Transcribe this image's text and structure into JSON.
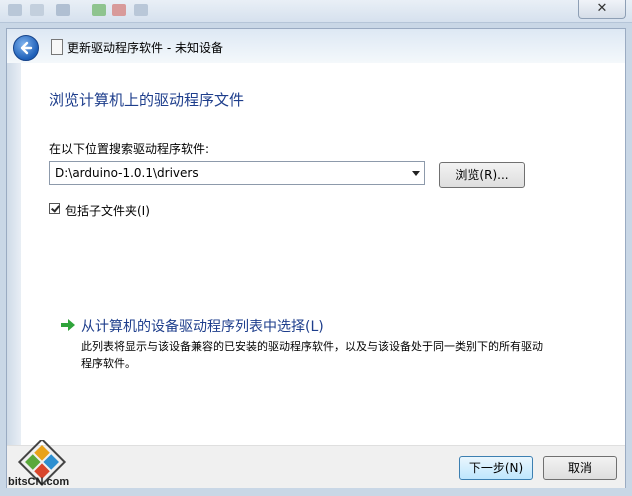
{
  "window": {
    "title": "更新驱动程序软件 - 未知设备",
    "close_glyph": "✕"
  },
  "page": {
    "heading": "浏览计算机上的驱动程序文件",
    "search_label": "在以下位置搜索驱动程序软件:",
    "path_value": "D:\\arduino-1.0.1\\drivers",
    "browse_label": "浏览(R)...",
    "include_subfolders_label": "包括子文件夹(I)",
    "include_subfolders_checked": true,
    "pick_link": "从计算机的设备驱动程序列表中选择(L)",
    "pick_description": "此列表将显示与该设备兼容的已安装的驱动程序软件，以及与该设备处于同一类别下的所有驱动程序软件。"
  },
  "footer": {
    "next_label": "下一步(N)",
    "cancel_label": "取消"
  },
  "watermark": {
    "logo_text": "bitsCN.com"
  },
  "colors": {
    "heading": "#1e3e8c",
    "link": "#1e3e8c",
    "arrow": "#2fa43a"
  }
}
